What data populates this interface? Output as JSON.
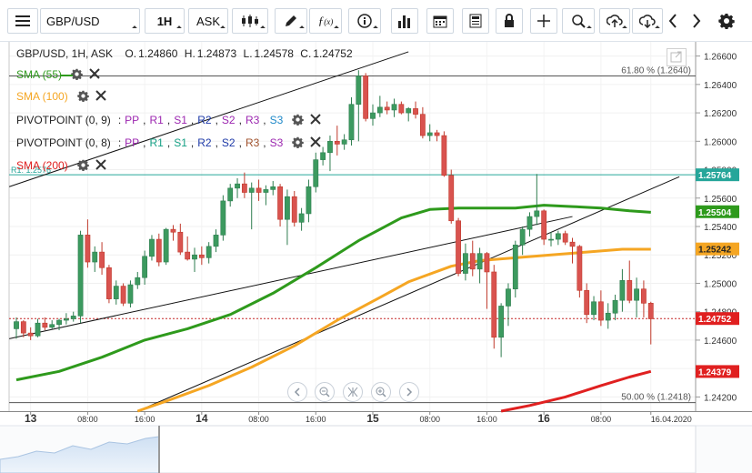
{
  "toolbar": {
    "symbol": "GBP/USD",
    "timeframe": "1H",
    "price_type": "ASK"
  },
  "header": {
    "title": "GBP/USD, 1H, ASK",
    "o_label": "O.",
    "o": "1.24860",
    "h_label": "H.",
    "h": "1.24873",
    "l_label": "L.",
    "l": "1.24578",
    "c_label": "C.",
    "c": "1.24752"
  },
  "legend": [
    {
      "label": "SMA (55)",
      "color": "#2e9a1c",
      "with_line": true
    },
    {
      "label": "SMA (100)",
      "color": "#f5a623",
      "with_line": false
    },
    {
      "label": "SMA (200)",
      "color": "#e02020",
      "with_line": false
    }
  ],
  "pivots": [
    {
      "label": "PIVOTPOINT (0, 9)",
      "items": [
        {
          "t": "PP",
          "c": "#9c27b0"
        },
        {
          "t": "R1",
          "c": "#9c27b0"
        },
        {
          "t": "S1",
          "c": "#9c27b0"
        },
        {
          "t": "R2",
          "c": "#1e3aa8"
        },
        {
          "t": "S2",
          "c": "#9c27b0"
        },
        {
          "t": "R3",
          "c": "#9c27b0"
        },
        {
          "t": "S3",
          "c": "#1e88c8"
        }
      ]
    },
    {
      "label": "PIVOTPOINT (0, 8)",
      "items": [
        {
          "t": "PP",
          "c": "#9c27b0"
        },
        {
          "t": "R1",
          "c": "#16a085"
        },
        {
          "t": "S1",
          "c": "#16a085"
        },
        {
          "t": "R2",
          "c": "#1e3aa8"
        },
        {
          "t": "S2",
          "c": "#1e3aa8"
        },
        {
          "t": "R3",
          "c": "#a0522d"
        },
        {
          "t": "S3",
          "c": "#9c27b0"
        }
      ]
    }
  ],
  "fib": {
    "top_label": "61.80 % (1.2640)",
    "bottom_label": "50.00 % (1.2418)",
    "r1_label": "R1: 1.2576"
  },
  "price_tags": [
    {
      "value": "1.25764",
      "bg": "#26a69a",
      "fg": "#ffffff"
    },
    {
      "value": "1.25504",
      "bg": "#2e9a1c",
      "fg": "#ffffff"
    },
    {
      "value": "1.25242",
      "bg": "#f5a623",
      "fg": "#222222"
    },
    {
      "value": "1.24752",
      "bg": "#e02020",
      "fg": "#ffffff"
    },
    {
      "value": "1.24379",
      "bg": "#e02020",
      "fg": "#ffffff"
    }
  ],
  "chart_data": {
    "type": "candlestick",
    "title": "GBP/USD, 1H, ASK",
    "ylim": [
      1.241,
      1.267
    ],
    "y_ticks": [
      "1.26600",
      "1.26400",
      "1.26200",
      "1.26000",
      "1.25800",
      "1.25600",
      "1.25400",
      "1.25200",
      "1.25000",
      "1.24800",
      "1.24600",
      "1.24400",
      "1.24200"
    ],
    "x_ticks": [
      {
        "label": "13",
        "bold": true,
        "bar": 2
      },
      {
        "label": "08:00",
        "bold": false,
        "bar": 10
      },
      {
        "label": "16:00",
        "bold": false,
        "bar": 18
      },
      {
        "label": "14",
        "bold": true,
        "bar": 26
      },
      {
        "label": "08:00",
        "bold": false,
        "bar": 34
      },
      {
        "label": "16:00",
        "bold": false,
        "bar": 42
      },
      {
        "label": "15",
        "bold": true,
        "bar": 50
      },
      {
        "label": "08:00",
        "bold": false,
        "bar": 58
      },
      {
        "label": "16:00",
        "bold": false,
        "bar": 66
      },
      {
        "label": "16",
        "bold": true,
        "bar": 74
      },
      {
        "label": "08:00",
        "bold": false,
        "bar": 82
      },
      {
        "label": "16.04.2020",
        "bold": false,
        "bar": 89
      }
    ],
    "candles": [
      [
        1.2468,
        1.2476,
        1.2461,
        1.2473
      ],
      [
        1.2473,
        1.2474,
        1.2462,
        1.2465
      ],
      [
        1.2465,
        1.2469,
        1.246,
        1.2463
      ],
      [
        1.2463,
        1.2475,
        1.2462,
        1.2472
      ],
      [
        1.2472,
        1.2476,
        1.2467,
        1.2469
      ],
      [
        1.2469,
        1.2474,
        1.2468,
        1.2471
      ],
      [
        1.2471,
        1.2475,
        1.2467,
        1.2474
      ],
      [
        1.2474,
        1.2479,
        1.2471,
        1.2475
      ],
      [
        1.2475,
        1.248,
        1.2473,
        1.2477
      ],
      [
        1.2477,
        1.2537,
        1.2472,
        1.2534
      ],
      [
        1.2534,
        1.2545,
        1.2511,
        1.2515
      ],
      [
        1.2515,
        1.2526,
        1.2508,
        1.2522
      ],
      [
        1.2522,
        1.2529,
        1.2506,
        1.2511
      ],
      [
        1.2511,
        1.2513,
        1.2486,
        1.2489
      ],
      [
        1.2489,
        1.2502,
        1.2485,
        1.2498
      ],
      [
        1.2498,
        1.25,
        1.2484,
        1.2486
      ],
      [
        1.2486,
        1.2502,
        1.2483,
        1.2499
      ],
      [
        1.2499,
        1.2508,
        1.2496,
        1.2504
      ],
      [
        1.2504,
        1.2523,
        1.2499,
        1.2519
      ],
      [
        1.2519,
        1.2534,
        1.2516,
        1.2531
      ],
      [
        1.2531,
        1.2535,
        1.2512,
        1.2515
      ],
      [
        1.2515,
        1.2539,
        1.2513,
        1.2538
      ],
      [
        1.2538,
        1.2541,
        1.253,
        1.2536
      ],
      [
        1.2536,
        1.2542,
        1.252,
        1.2522
      ],
      [
        1.2522,
        1.2533,
        1.2516,
        1.2517
      ],
      [
        1.2517,
        1.2525,
        1.2508,
        1.252
      ],
      [
        1.252,
        1.2526,
        1.2513,
        1.2518
      ],
      [
        1.2518,
        1.2529,
        1.2514,
        1.2526
      ],
      [
        1.2526,
        1.2538,
        1.2522,
        1.2534
      ],
      [
        1.2534,
        1.2562,
        1.253,
        1.2558
      ],
      [
        1.2558,
        1.257,
        1.2554,
        1.2567
      ],
      [
        1.2567,
        1.2574,
        1.256,
        1.257
      ],
      [
        1.257,
        1.2578,
        1.256,
        1.2564
      ],
      [
        1.2564,
        1.2571,
        1.2538,
        1.2567
      ],
      [
        1.2567,
        1.2573,
        1.2558,
        1.2564
      ],
      [
        1.2564,
        1.2569,
        1.2555,
        1.2566
      ],
      [
        1.2566,
        1.2572,
        1.2562,
        1.2568
      ],
      [
        1.2568,
        1.257,
        1.254,
        1.2545
      ],
      [
        1.2545,
        1.2566,
        1.2527,
        1.2561
      ],
      [
        1.2561,
        1.2565,
        1.254,
        1.2543
      ],
      [
        1.2543,
        1.2553,
        1.2537,
        1.2549
      ],
      [
        1.2549,
        1.2573,
        1.2543,
        1.2568
      ],
      [
        1.2568,
        1.2592,
        1.2564,
        1.2587
      ],
      [
        1.2587,
        1.2596,
        1.2583,
        1.2592
      ],
      [
        1.2592,
        1.2604,
        1.2579,
        1.26
      ],
      [
        1.26,
        1.2611,
        1.259,
        1.2598
      ],
      [
        1.2598,
        1.2605,
        1.2594,
        1.2601
      ],
      [
        1.2601,
        1.2631,
        1.2597,
        1.2626
      ],
      [
        1.2626,
        1.265,
        1.26,
        1.2646
      ],
      [
        1.2646,
        1.2648,
        1.2614,
        1.2616
      ],
      [
        1.2616,
        1.2626,
        1.2611,
        1.262
      ],
      [
        1.262,
        1.2632,
        1.2617,
        1.2624
      ],
      [
        1.2624,
        1.2628,
        1.2619,
        1.2622
      ],
      [
        1.2622,
        1.263,
        1.2617,
        1.2626
      ],
      [
        1.2626,
        1.2628,
        1.2619,
        1.262
      ],
      [
        1.262,
        1.2624,
        1.2614,
        1.2623
      ],
      [
        1.2623,
        1.2628,
        1.2616,
        1.2619
      ],
      [
        1.2619,
        1.2624,
        1.2602,
        1.2604
      ],
      [
        1.2604,
        1.2612,
        1.26,
        1.2606
      ],
      [
        1.2606,
        1.2608,
        1.26,
        1.2604
      ],
      [
        1.2604,
        1.2607,
        1.2575,
        1.2576
      ],
      [
        1.2576,
        1.258,
        1.2542,
        1.2544
      ],
      [
        1.2544,
        1.2546,
        1.2505,
        1.2507
      ],
      [
        1.2507,
        1.2528,
        1.2502,
        1.2521
      ],
      [
        1.2521,
        1.253,
        1.2505,
        1.251
      ],
      [
        1.251,
        1.2525,
        1.25,
        1.2521
      ],
      [
        1.2521,
        1.2522,
        1.2482,
        1.2508
      ],
      [
        1.2508,
        1.2513,
        1.2454,
        1.2462
      ],
      [
        1.2462,
        1.2486,
        1.2448,
        1.2484
      ],
      [
        1.2484,
        1.25,
        1.247,
        1.2496
      ],
      [
        1.2496,
        1.253,
        1.249,
        1.2527
      ],
      [
        1.2527,
        1.254,
        1.252,
        1.2538
      ],
      [
        1.2538,
        1.255,
        1.2533,
        1.2547
      ],
      [
        1.2547,
        1.2577,
        1.2541,
        1.2551
      ],
      [
        1.2551,
        1.2552,
        1.2527,
        1.2531
      ],
      [
        1.2531,
        1.2536,
        1.2526,
        1.2531
      ],
      [
        1.2531,
        1.2537,
        1.2527,
        1.2535
      ],
      [
        1.2535,
        1.2537,
        1.2527,
        1.2529
      ],
      [
        1.2529,
        1.2532,
        1.2514,
        1.2526
      ],
      [
        1.2526,
        1.2527,
        1.249,
        1.2495
      ],
      [
        1.2495,
        1.25,
        1.2472,
        1.2478
      ],
      [
        1.2478,
        1.2491,
        1.2474,
        1.2487
      ],
      [
        1.2487,
        1.2495,
        1.247,
        1.2474
      ],
      [
        1.2474,
        1.2486,
        1.2468,
        1.2479
      ],
      [
        1.2479,
        1.2492,
        1.2474,
        1.2488
      ],
      [
        1.2488,
        1.251,
        1.248,
        1.2502
      ],
      [
        1.2502,
        1.2516,
        1.2486,
        1.2488
      ],
      [
        1.2488,
        1.2504,
        1.2476,
        1.2496
      ],
      [
        1.2496,
        1.2502,
        1.2476,
        1.2486
      ],
      [
        1.2486,
        1.2487,
        1.2457,
        1.2475
      ]
    ],
    "series": [
      {
        "name": "SMA (55)",
        "color": "#2e9a1c",
        "values": [
          [
            0,
            1.2432
          ],
          [
            6,
            1.2438
          ],
          [
            12,
            1.2448
          ],
          [
            18,
            1.246
          ],
          [
            24,
            1.2468
          ],
          [
            30,
            1.2478
          ],
          [
            36,
            1.2493
          ],
          [
            42,
            1.2511
          ],
          [
            48,
            1.253
          ],
          [
            54,
            1.2546
          ],
          [
            58,
            1.2552
          ],
          [
            62,
            1.2553
          ],
          [
            66,
            1.2553
          ],
          [
            70,
            1.2553
          ],
          [
            74,
            1.2555
          ],
          [
            78,
            1.2554
          ],
          [
            82,
            1.2553
          ],
          [
            86,
            1.2551
          ],
          [
            89,
            1.255
          ]
        ]
      },
      {
        "name": "SMA (100)",
        "color": "#f5a623",
        "values": [
          [
            17,
            1.241
          ],
          [
            21,
            1.2417
          ],
          [
            27,
            1.2428
          ],
          [
            33,
            1.2441
          ],
          [
            39,
            1.2456
          ],
          [
            45,
            1.2474
          ],
          [
            51,
            1.249
          ],
          [
            55,
            1.2501
          ],
          [
            61,
            1.2512
          ],
          [
            65,
            1.2516
          ],
          [
            70,
            1.2518
          ],
          [
            75,
            1.252
          ],
          [
            80,
            1.2522
          ],
          [
            85,
            1.2524
          ],
          [
            89,
            1.2524
          ]
        ]
      },
      {
        "name": "SMA (200)",
        "color": "#e02020",
        "values": [
          [
            68,
            1.241
          ],
          [
            72,
            1.2414
          ],
          [
            77,
            1.242
          ],
          [
            82,
            1.2428
          ],
          [
            86,
            1.2434
          ],
          [
            89,
            1.2438
          ]
        ]
      }
    ],
    "trendlines": [
      {
        "from": [
          -1,
          1.2568
        ],
        "to": [
          55,
          1.2663
        ]
      },
      {
        "from": [
          -1,
          1.2461
        ],
        "to": [
          78,
          1.2547
        ]
      },
      {
        "from": [
          17,
          1.241
        ],
        "to": [
          93,
          1.2575
        ]
      }
    ],
    "current_price": 1.24752,
    "r1_level": 1.25764,
    "fib_top_level": 1.2646,
    "fib_bottom_level": 1.2416
  }
}
